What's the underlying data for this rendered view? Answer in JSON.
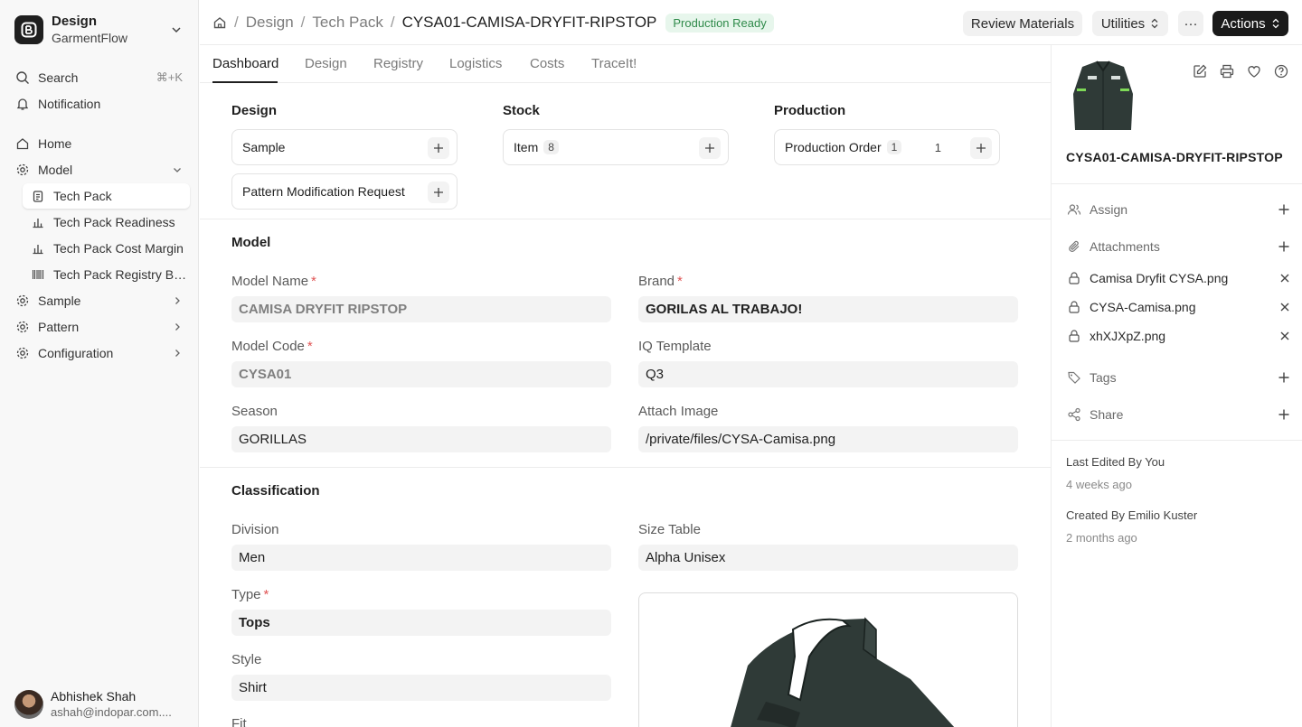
{
  "workspace": {
    "name": "Design",
    "subtitle": "GarmentFlow"
  },
  "sidebar": {
    "search": {
      "label": "Search",
      "shortcut": "⌘+K"
    },
    "notification": "Notification",
    "items": [
      {
        "label": "Home"
      },
      {
        "label": "Model",
        "expanded": true
      },
      {
        "label": "Tech Pack",
        "active": true
      },
      {
        "label": "Tech Pack Readiness"
      },
      {
        "label": "Tech Pack Cost Margin"
      },
      {
        "label": "Tech Pack Registry Ba..."
      },
      {
        "label": "Sample"
      },
      {
        "label": "Pattern"
      },
      {
        "label": "Configuration"
      }
    ],
    "user": {
      "name": "Abhishek Shah",
      "email": "ashah@indopar.com...."
    }
  },
  "header": {
    "breadcrumb": [
      "Design",
      "Tech Pack",
      "CYSA01-CAMISA-DRYFIT-RIPSTOP"
    ],
    "status": "Production Ready",
    "review_label": "Review Materials",
    "utilities_label": "Utilities",
    "more_label": "···",
    "actions_label": "Actions"
  },
  "tabs": [
    "Dashboard",
    "Design",
    "Registry",
    "Logistics",
    "Costs",
    "TraceIt!"
  ],
  "dashboard": {
    "design": {
      "title": "Design",
      "links": [
        "Sample",
        "Pattern Modification Request"
      ]
    },
    "stock": {
      "title": "Stock",
      "link": "Item",
      "count": "8"
    },
    "production": {
      "title": "Production",
      "link": "Production Order",
      "count": "1",
      "value": "1"
    }
  },
  "model": {
    "title": "Model",
    "fields": {
      "model_name": {
        "label": "Model Name",
        "value": "CAMISA DRYFIT RIPSTOP"
      },
      "brand": {
        "label": "Brand",
        "value": "GORILAS AL TRABAJO!"
      },
      "model_code": {
        "label": "Model Code",
        "value": "CYSA01"
      },
      "iq_template": {
        "label": "IQ Template",
        "value": "Q3"
      },
      "season": {
        "label": "Season",
        "value": "GORILLAS"
      },
      "attach_image": {
        "label": "Attach Image",
        "value": "/private/files/CYSA-Camisa.png"
      }
    }
  },
  "classification": {
    "title": "Classification",
    "fields": {
      "division": {
        "label": "Division",
        "value": "Men"
      },
      "size_table": {
        "label": "Size Table",
        "value": "Alpha Unisex"
      },
      "type": {
        "label": "Type",
        "value": "Tops"
      },
      "style": {
        "label": "Style",
        "value": "Shirt"
      },
      "fit": {
        "label": "Fit"
      }
    }
  },
  "right_panel": {
    "title": "CYSA01-CAMISA-DRYFIT-RIPSTOP",
    "assign": "Assign",
    "attachments": "Attachments",
    "files": [
      "Camisa Dryfit CYSA.png",
      "CYSA-Camisa.png",
      "xhXJXpZ.png"
    ],
    "tags": "Tags",
    "share": "Share",
    "last_edited": "Last Edited By You",
    "last_edited_time": "4 weeks ago",
    "created_by": "Created By Emilio Kuster",
    "created_time": "2 months ago"
  },
  "colors": {
    "accent": "#1a1a1a",
    "status_green": "#2f8a4a",
    "status_green_bg": "#e7f6ec",
    "required": "#e05555",
    "garment": "#2f3a37"
  }
}
